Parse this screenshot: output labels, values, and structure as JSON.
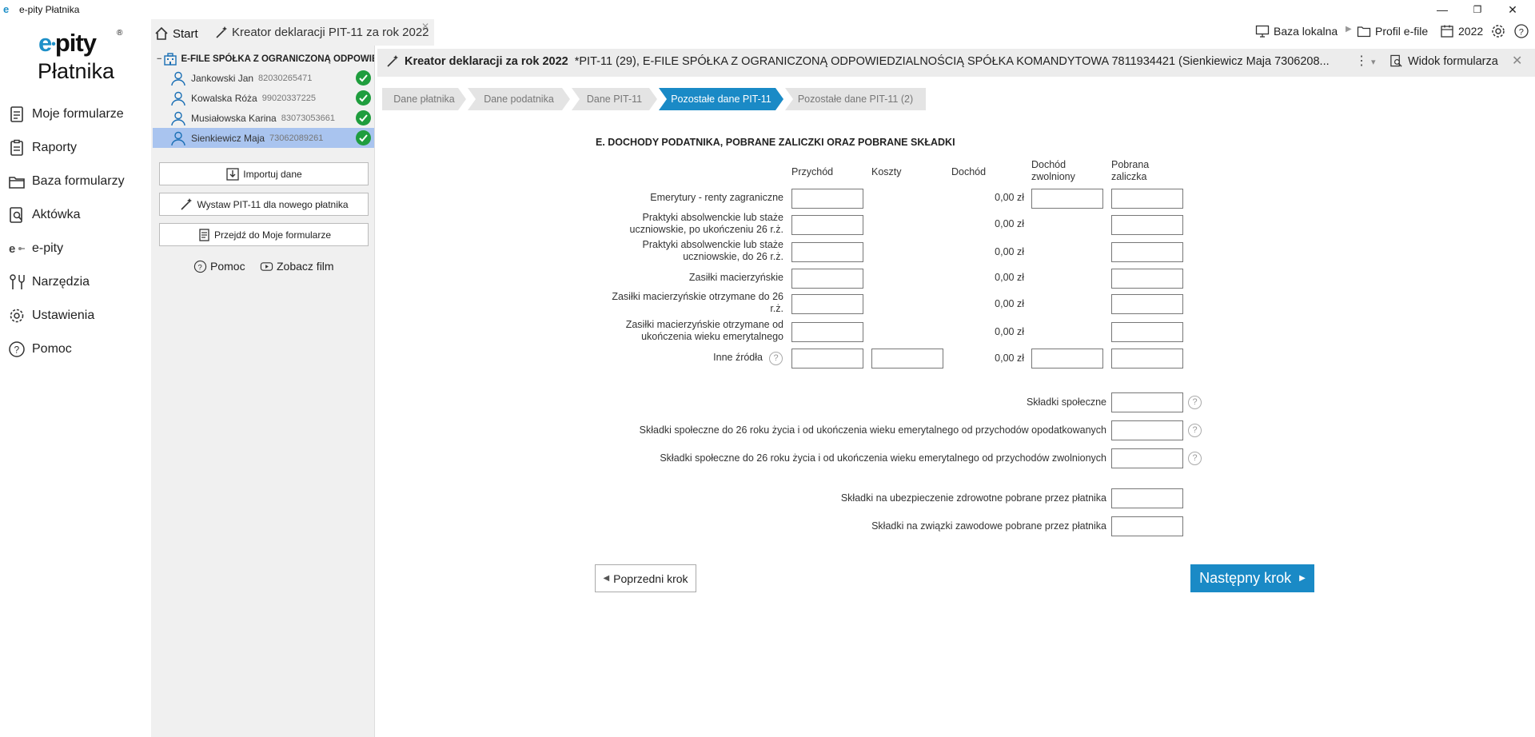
{
  "window": {
    "logo_glyph": "e",
    "title": "e-pity Płatnika",
    "minimize": "—",
    "maximize": "❐",
    "close": "✕"
  },
  "brand": {
    "line1_e": "e",
    "line1_dot": "•",
    "line1_rest": "pity",
    "reg": "®",
    "line2": "Płatnika"
  },
  "nav": [
    {
      "label": "Moje formularze",
      "icon": "document-icon"
    },
    {
      "label": "Raporty",
      "icon": "clipboard-icon"
    },
    {
      "label": "Baza formularzy",
      "icon": "folder-icon"
    },
    {
      "label": "Aktówka",
      "icon": "search-document-icon"
    },
    {
      "label": "e-pity",
      "icon": "epity-logo-icon"
    },
    {
      "label": "Narzędzia",
      "icon": "tools-icon"
    },
    {
      "label": "Ustawienia",
      "icon": "gear-icon"
    },
    {
      "label": "Pomoc",
      "icon": "help-icon"
    }
  ],
  "tabs": {
    "start": "Start",
    "kreator": "Kreator deklaracji PIT-11 za rok 2022",
    "close": "✕"
  },
  "tree": {
    "toggle": "−",
    "root": "E-FILE SPÓŁKA Z OGRANICZONĄ ODPOWIEDZIALNOŚCIĄ",
    "people": [
      {
        "name": "Jankowski Jan",
        "nip": "82030265471"
      },
      {
        "name": "Kowalska Róża",
        "nip": "99020337225"
      },
      {
        "name": "Musiałowska Karina",
        "nip": "83073053661"
      },
      {
        "name": "Sienkiewicz Maja",
        "nip": "73062089261"
      }
    ]
  },
  "side_buttons": {
    "import": "Importuj dane",
    "wystaw": "Wystaw PIT-11 dla nowego płatnika",
    "przejdz": "Przejdź do Moje formularze"
  },
  "help_links": {
    "pomoc": "Pomoc",
    "film": "Zobacz film"
  },
  "topbar": {
    "baza": "Baza lokalna",
    "sep": "▶",
    "profil": "Profil e-file",
    "year": "2022"
  },
  "form_header": {
    "title_bold": "Kreator deklaracji za rok 2022",
    "title_rest": "*PIT-11 (29), E-FILE SPÓŁKA Z OGRANICZONĄ ODPOWIEDZIALNOŚCIĄ SPÓŁKA KOMANDYTOWA 7811934421 (Sienkiewicz Maja 7306208...",
    "dots": "⋮",
    "dropdown": "▾",
    "widok": "Widok formularza",
    "close": "✕"
  },
  "steps": [
    "Dane płatnika",
    "Dane podatnika",
    "Dane PIT-11",
    "Pozostałe dane PIT-11",
    "Pozostałe dane PIT-11 (2)"
  ],
  "section": {
    "title": "E. DOCHODY PODATNIKA, POBRANE ZALICZKI ORAZ POBRANE SKŁADKI",
    "cols": {
      "przychod": "Przychód",
      "koszty": "Koszty",
      "dochod": "Dochód",
      "zwolniony_1": "Dochód",
      "zwolniony_2": "zwolniony",
      "zaliczka_1": "Pobrana",
      "zaliczka_2": "zaliczka"
    },
    "rows": [
      {
        "l1": "Emerytury - renty zagraniczne",
        "l2": "",
        "dochod": "0,00 zł"
      },
      {
        "l1": "Praktyki absolwenckie lub staże",
        "l2": "uczniowskie, po ukończeniu 26 r.ż.",
        "dochod": "0,00 zł"
      },
      {
        "l1": "Praktyki absolwenckie lub staże",
        "l2": "uczniowskie, do 26 r.ż.",
        "dochod": "0,00 zł"
      },
      {
        "l1": "Zasiłki macierzyńskie",
        "l2": "",
        "dochod": "0,00 zł"
      },
      {
        "l1": "Zasiłki macierzyńskie otrzymane do 26",
        "l2": "r.ż.",
        "dochod": "0,00 zł"
      },
      {
        "l1": "Zasiłki macierzyńskie otrzymane od",
        "l2": "ukończenia wieku emerytalnego",
        "dochod": "0,00 zł"
      },
      {
        "l1": "Inne źródła",
        "l2": "",
        "dochod": "0,00 zł"
      }
    ],
    "qmark": "?",
    "skladki": [
      "Składki społeczne",
      "Składki społeczne do 26 roku życia i od ukończenia wieku emerytalnego od przychodów opodatkowanych",
      "Składki społeczne do 26 roku życia i od ukończenia wieku emerytalnego od przychodów zwolnionych"
    ],
    "skladki2": [
      "Składki na ubezpieczenie zdrowotne pobrane przez płatnika",
      "Składki na związki zawodowe pobrane przez płatnika"
    ]
  },
  "nav_buttons": {
    "prev_arrow": "◀",
    "prev": "Poprzedni krok",
    "next": "Następny krok",
    "next_arrow": "▶"
  }
}
